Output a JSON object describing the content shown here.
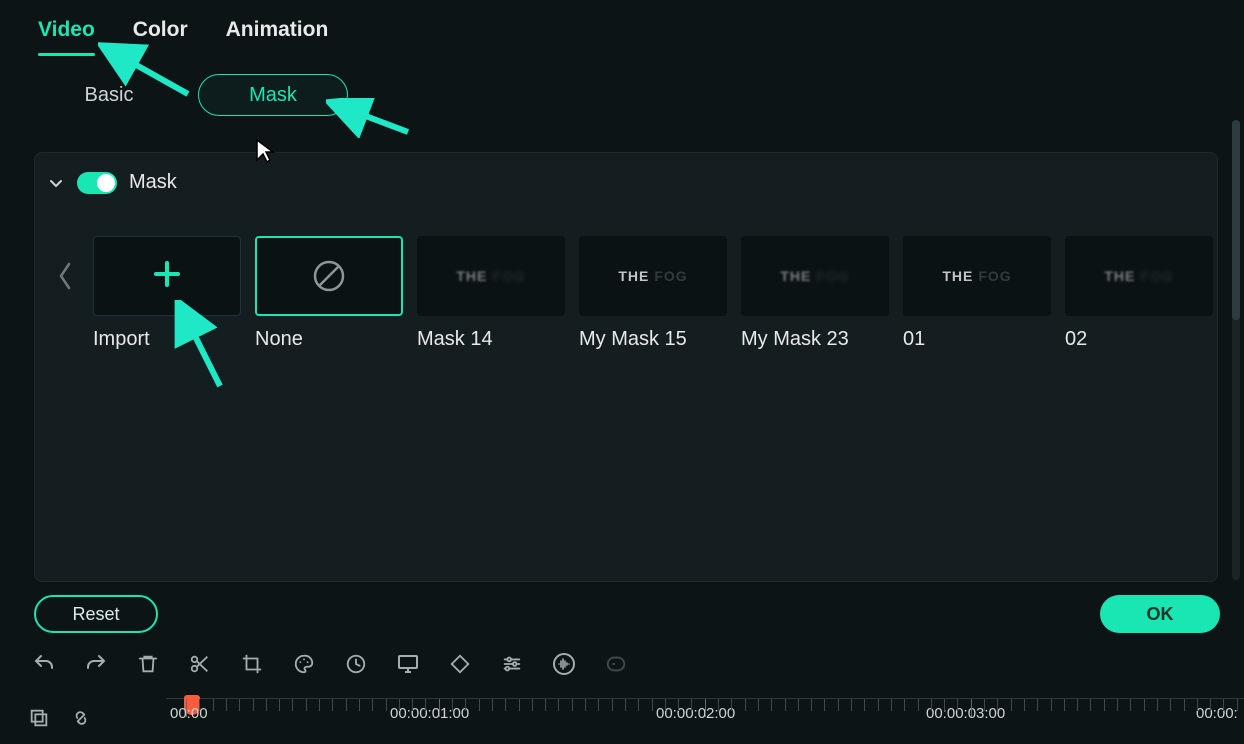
{
  "tabs": {
    "video": "Video",
    "color": "Color",
    "animation": "Animation"
  },
  "sub_tabs": {
    "basic": "Basic",
    "mask": "Mask"
  },
  "panel": {
    "title": "Mask",
    "enabled": true
  },
  "masks": [
    {
      "label": "Import"
    },
    {
      "label": "None"
    },
    {
      "label": "Mask 14",
      "thumb_text_a": "THE",
      "thumb_text_b": "FOG"
    },
    {
      "label": "My Mask 15",
      "thumb_text_a": "THE",
      "thumb_text_b": "FOG"
    },
    {
      "label": "My Mask 23",
      "thumb_text_a": "THE",
      "thumb_text_b": "FOG"
    },
    {
      "label": "01",
      "thumb_text_a": "THE",
      "thumb_text_b": "FOG"
    },
    {
      "label": "02",
      "thumb_text_a": "THE",
      "thumb_text_b": "FOG"
    }
  ],
  "footer": {
    "reset": "Reset",
    "ok": "OK"
  },
  "timeline": {
    "t0": "00:00",
    "t1": "00:00:01:00",
    "t2": "00:00:02:00",
    "t3": "00:00:03:00",
    "t4": "00:00:"
  },
  "colors": {
    "accent": "#19e6b3"
  }
}
